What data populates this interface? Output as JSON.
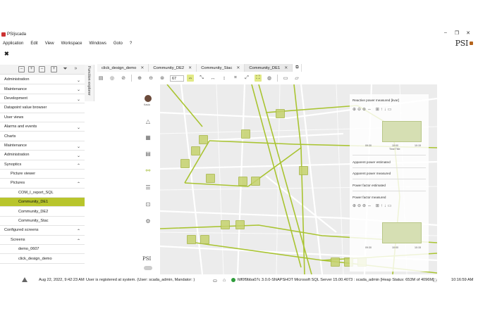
{
  "window": {
    "title": "PSIjscada",
    "controls": [
      "–",
      "❐",
      "✕"
    ]
  },
  "menu": [
    "Application",
    "Edit",
    "View",
    "Workspace",
    "Windows",
    "Goto",
    "?"
  ],
  "brand": "PSI",
  "close_label": "✖",
  "vertical_tab": "Function explorer",
  "nav": [
    {
      "label": "Administration",
      "level": 0,
      "chev": "⌄"
    },
    {
      "label": "Maintenance",
      "level": 0,
      "chev": "⌄"
    },
    {
      "label": "Development",
      "level": 0,
      "chev": "⌄"
    },
    {
      "label": "Datapoint value browser",
      "level": 0,
      "chev": ""
    },
    {
      "label": "User views",
      "level": 0,
      "chev": ""
    },
    {
      "label": "Alarms and events",
      "level": 0,
      "chev": "⌄"
    },
    {
      "label": "Charts",
      "level": 0,
      "chev": ""
    },
    {
      "label": "Maintenance",
      "level": 0,
      "chev": "⌄"
    },
    {
      "label": "Administration",
      "level": 0,
      "chev": "⌄"
    },
    {
      "label": "Synoptics",
      "level": 0,
      "chev": "⌃"
    },
    {
      "label": "Picture viewer",
      "level": 1,
      "chev": ""
    },
    {
      "label": "Pictures",
      "level": 1,
      "chev": "⌃"
    },
    {
      "label": "COM_I_report_SQL",
      "level": 2,
      "chev": ""
    },
    {
      "label": "Community_DE1",
      "level": 2,
      "chev": "",
      "selected": true
    },
    {
      "label": "Community_DE2",
      "level": 2,
      "chev": ""
    },
    {
      "label": "Community_Stac",
      "level": 2,
      "chev": ""
    },
    {
      "label": "Configured screens",
      "level": 0,
      "chev": "⌃"
    },
    {
      "label": "Screens",
      "level": 1,
      "chev": "⌃"
    },
    {
      "label": "demo_0607",
      "level": 2,
      "chev": ""
    },
    {
      "label": "click_design_demo",
      "level": 2,
      "chev": ""
    }
  ],
  "tabs": [
    {
      "label": "click_design_demo",
      "close": "✕"
    },
    {
      "label": "Community_DE2",
      "close": "✕"
    },
    {
      "label": "Community_Stac",
      "close": "✕"
    },
    {
      "label": "Community_DE1",
      "close": "✕",
      "active": true
    }
  ],
  "tab_add": "⧉",
  "toolbar": {
    "zoom_value": "67"
  },
  "avatar_label": "Kasia",
  "psi_small": "PSI",
  "panel": {
    "items": [
      "Reactive power measured [kvar]",
      "Apparent power estimated",
      "Apparent power measured",
      "Power factor estimated",
      "Power factor measured"
    ],
    "chart_ticks": [
      "09:30",
      "10:00",
      "10:15"
    ],
    "chart_xlabel": "Time Title"
  },
  "status": {
    "datetime": "Aug 22, 2022, 9:42:23 AM",
    "message": "User is registered at system. (User: scada_admin, Mandator: )",
    "server": "fdf0f9bba07c 3.0.0-SNAPSHOT Microsoft SQL Server 15.00.4073 : scada_admin [Heap Status: 653M of 4096M]",
    "clock": "10:16:59 AM"
  },
  "colors": {
    "accent": "#b8c52c",
    "line": "#a9c431",
    "map_bg": "#ececec"
  }
}
